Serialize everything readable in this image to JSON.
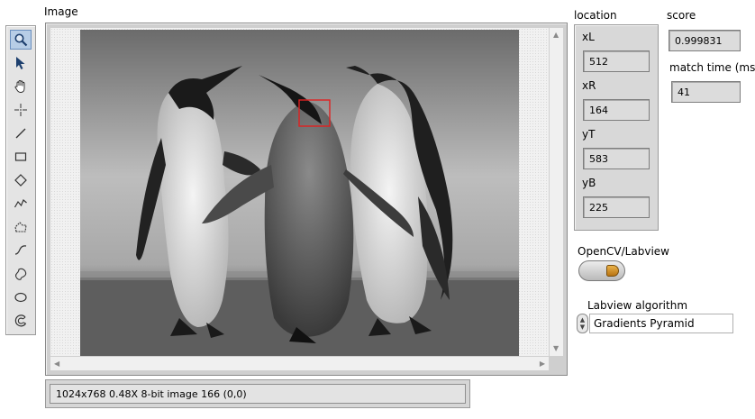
{
  "image_display": {
    "label": "Image",
    "status_text": "1024x768 0.48X 8-bit image 166     (0,0)"
  },
  "tools": [
    {
      "name": "zoom-icon",
      "selected": true
    },
    {
      "name": "select-arrow-icon"
    },
    {
      "name": "pan-hand-icon"
    },
    {
      "name": "point-crosshair-icon"
    },
    {
      "name": "line-icon"
    },
    {
      "name": "rectangle-icon"
    },
    {
      "name": "rotated-rectangle-icon"
    },
    {
      "name": "polyline-icon"
    },
    {
      "name": "polygon-icon"
    },
    {
      "name": "freehand-line-icon"
    },
    {
      "name": "freehand-region-icon"
    },
    {
      "name": "oval-icon"
    },
    {
      "name": "annulus-icon"
    }
  ],
  "location": {
    "label": "location",
    "xL_label": "xL",
    "xL": "512",
    "xR_label": "xR",
    "xR": "164",
    "yT_label": "yT",
    "yT": "583",
    "yB_label": "yB",
    "yB": "225"
  },
  "score": {
    "label": "score",
    "value": "0.999831"
  },
  "match_time": {
    "label": "match time (ms)",
    "value": "41"
  },
  "toggle": {
    "label": "OpenCV/Labview"
  },
  "algorithm": {
    "label": "Labview algorithm",
    "value": "Gradients Pyramid"
  },
  "colors": {
    "match_box": "#e02020",
    "toggle_led": "#d08a20",
    "selected_tool": "#b7cde6"
  }
}
